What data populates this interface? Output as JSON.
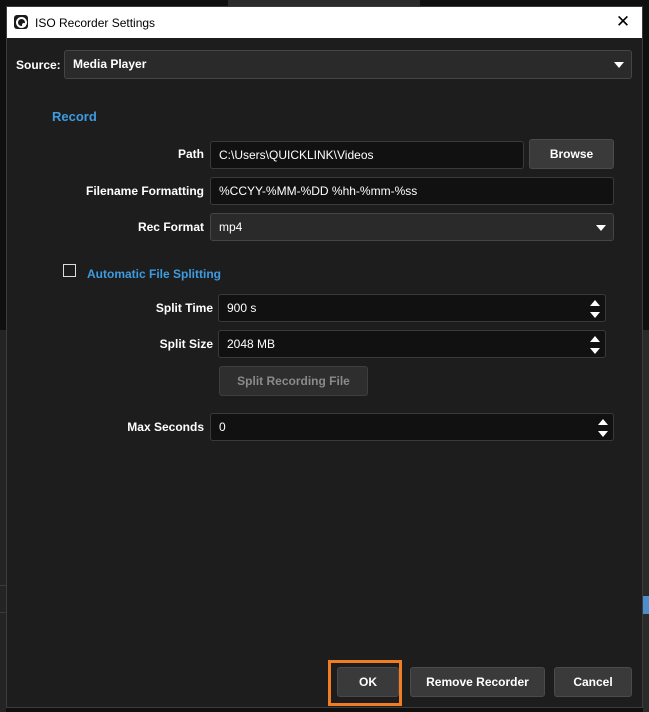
{
  "window": {
    "title": "ISO Recorder Settings",
    "close_glyph": "✕"
  },
  "source": {
    "label": "Source:",
    "value": "Media Player"
  },
  "record": {
    "heading": "Record",
    "path_label": "Path",
    "path_value": "C:\\Users\\QUICKLINK\\Videos",
    "browse_label": "Browse",
    "filename_label": "Filename Formatting",
    "filename_value": "%CCYY-%MM-%DD %hh-%mm-%ss",
    "rec_format_label": "Rec Format",
    "rec_format_value": "mp4"
  },
  "splitting": {
    "heading": "Automatic File Splitting",
    "checked": false,
    "split_time_label": "Split Time",
    "split_time_value": "900 s",
    "split_size_label": "Split Size",
    "split_size_value": "2048 MB",
    "split_button_label": "Split Recording File"
  },
  "max_seconds": {
    "label": "Max Seconds",
    "value": "0"
  },
  "footer": {
    "ok_label": "OK",
    "remove_label": "Remove Recorder",
    "cancel_label": "Cancel"
  },
  "colors": {
    "accent": "#3d9be0",
    "highlight": "#f07d24",
    "panel": "#1d1d1d"
  }
}
